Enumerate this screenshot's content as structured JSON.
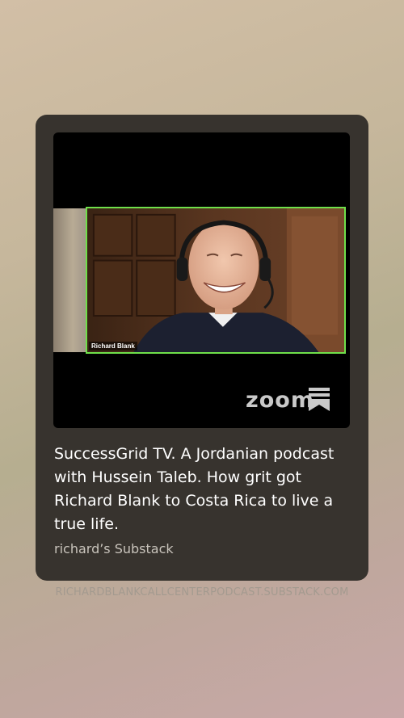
{
  "card": {
    "title": "SuccessGrid TV. A Jordanian podcast with Hussein Taleb. How grit got Richard Blank to Costa Rica to live a true life.",
    "publication": "richard’s Substack"
  },
  "video": {
    "participant_name": "Richard Blank",
    "logo_text": "zoom",
    "logo_icon": "zoom-bookmark-icon",
    "active_speaker_border_color": "#6fe04a"
  },
  "footer": {
    "source_url": "RICHARDBLANKCALLCENTERPODCAST.SUBSTACK.COM"
  }
}
